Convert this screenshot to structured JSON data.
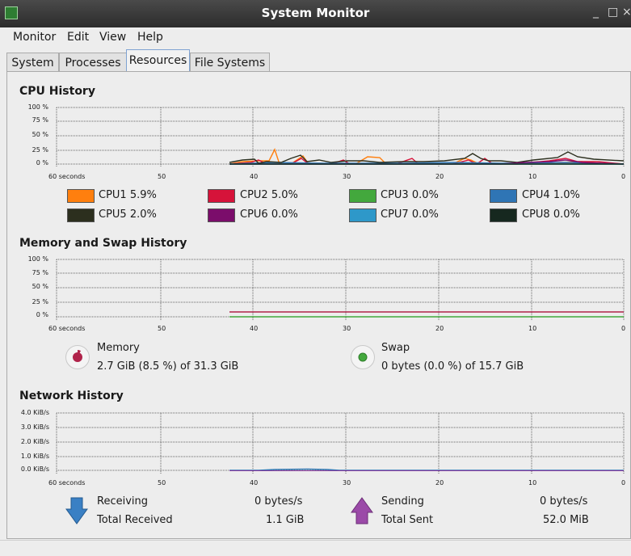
{
  "window": {
    "title": "System Monitor",
    "minimize": "_",
    "maximize": "□",
    "close": "×"
  },
  "menu": [
    "Monitor",
    "Edit",
    "View",
    "Help"
  ],
  "tabs": [
    "System",
    "Processes",
    "Resources",
    "File Systems"
  ],
  "cpu": {
    "title": "CPU History",
    "y_ticks": [
      "100 %",
      "75 %",
      "50 %",
      "25 %",
      "0 %"
    ],
    "x_ticks": [
      "60 seconds",
      "50",
      "40",
      "30",
      "20",
      "10",
      "0"
    ],
    "legend": [
      {
        "label": "CPU1 5.9%",
        "color": "#ff7f0e"
      },
      {
        "label": "CPU2 5.0%",
        "color": "#d6133a"
      },
      {
        "label": "CPU3 0.0%",
        "color": "#43a83d"
      },
      {
        "label": "CPU4 1.0%",
        "color": "#2f75b5"
      },
      {
        "label": "CPU5 2.0%",
        "color": "#2c2f1e"
      },
      {
        "label": "CPU6 0.0%",
        "color": "#7b0d6b"
      },
      {
        "label": "CPU7 0.0%",
        "color": "#2e98c9"
      },
      {
        "label": "CPU8 0.0%",
        "color": "#16281f"
      }
    ]
  },
  "memory": {
    "title": "Memory and Swap History",
    "y_ticks": [
      "100 %",
      "75 %",
      "50 %",
      "25 %",
      "0 %"
    ],
    "x_ticks": [
      "60 seconds",
      "50",
      "40",
      "30",
      "20",
      "10",
      "0"
    ],
    "memory_label": "Memory",
    "memory_value": "2.7 GiB (8.5 %) of 31.3 GiB",
    "memory_color": "#b0234a",
    "swap_label": "Swap",
    "swap_value": "0 bytes (0.0 %) of 15.7 GiB",
    "swap_color": "#43a83d"
  },
  "network": {
    "title": "Network History",
    "y_ticks": [
      "4.0 KiB/s",
      "3.0 KiB/s",
      "2.0 KiB/s",
      "1.0 KiB/s",
      "0.0 KiB/s"
    ],
    "x_ticks": [
      "60 seconds",
      "50",
      "40",
      "30",
      "20",
      "10",
      "0"
    ],
    "receiving_label": "Receiving",
    "receiving_value": "0 bytes/s",
    "total_received_label": "Total Received",
    "total_received_value": "1.1 GiB",
    "sending_label": "Sending",
    "sending_value": "0 bytes/s",
    "total_sent_label": "Total Sent",
    "total_sent_value": "52.0 MiB",
    "receive_color": "#2f75b5",
    "send_color": "#8e3a9c"
  }
}
